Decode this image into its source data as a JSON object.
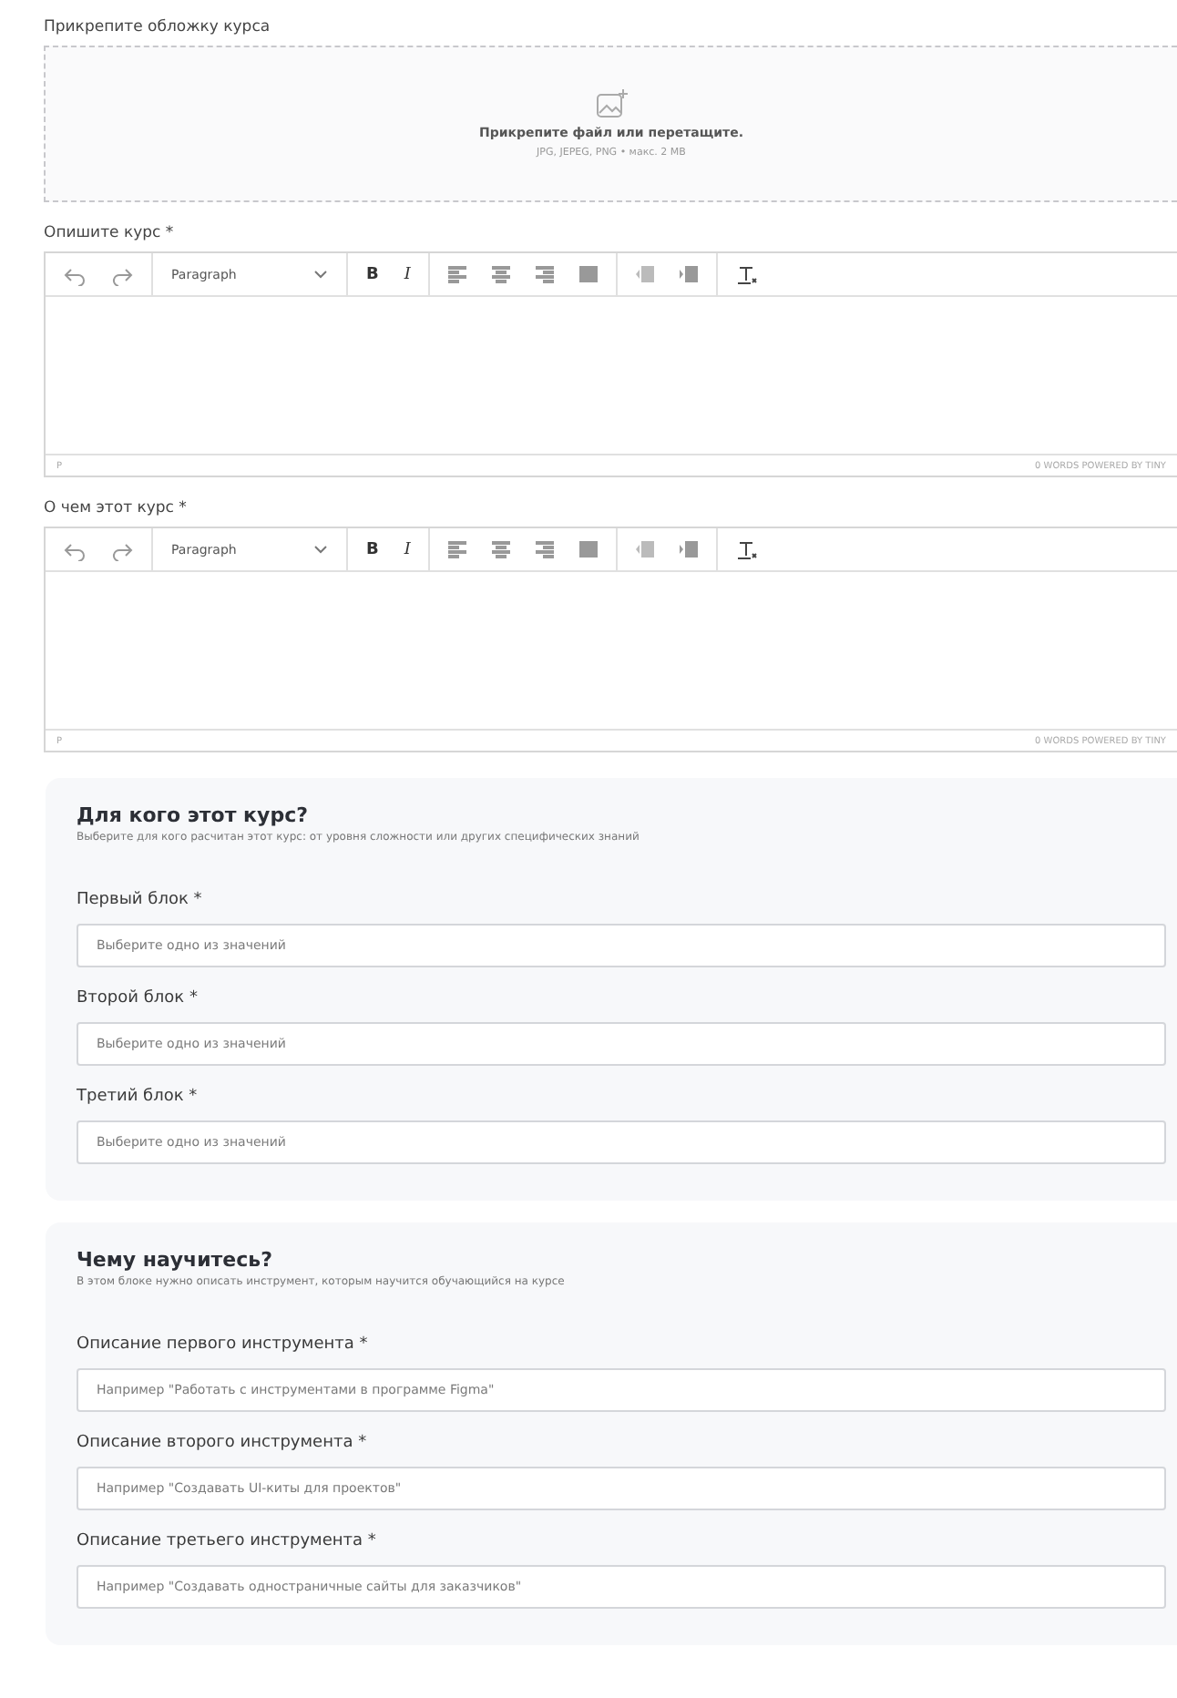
{
  "cover": {
    "label": "Прикрепите обложку курса",
    "prompt": "Прикрепите файл или перетащите.",
    "hint": "JPG, JEPEG, PNG • макс. 2 MB"
  },
  "editors": [
    {
      "label": "Опишите курс *",
      "format": "Paragraph",
      "bold": "B",
      "italic": "I",
      "status_path": "P",
      "status_info": "0 WORDS  POWERED BY TINY"
    },
    {
      "label": "О чем этот курс *",
      "format": "Paragraph",
      "bold": "B",
      "italic": "I",
      "status_path": "P",
      "status_info": "0 WORDS  POWERED BY TINY"
    }
  ],
  "sections": [
    {
      "title": "Для кого этот курс?",
      "subtitle": "Выберите для кого расчитан этот курс: от уровня сложности или других специфических знаний",
      "fields": [
        {
          "label": "Первый блок *",
          "placeholder": "Выберите одно из значений"
        },
        {
          "label": "Второй блок *",
          "placeholder": "Выберите одно из значений"
        },
        {
          "label": "Третий блок *",
          "placeholder": "Выберите одно из значений"
        }
      ]
    },
    {
      "title": "Чему научитесь?",
      "subtitle": "В этом блоке нужно описать инструмент, которым научится обучающийся на курсе",
      "fields": [
        {
          "label": "Описание первого инструмента *",
          "placeholder": "Например \"Работать с инструментами в программе Figma\""
        },
        {
          "label": "Описание второго инструмента *",
          "placeholder": "Например \"Создавать UI-киты для проектов\""
        },
        {
          "label": "Описание третьего инструмента *",
          "placeholder": "Например \"Создавать одностраничные сайты для заказчиков\""
        }
      ]
    }
  ]
}
